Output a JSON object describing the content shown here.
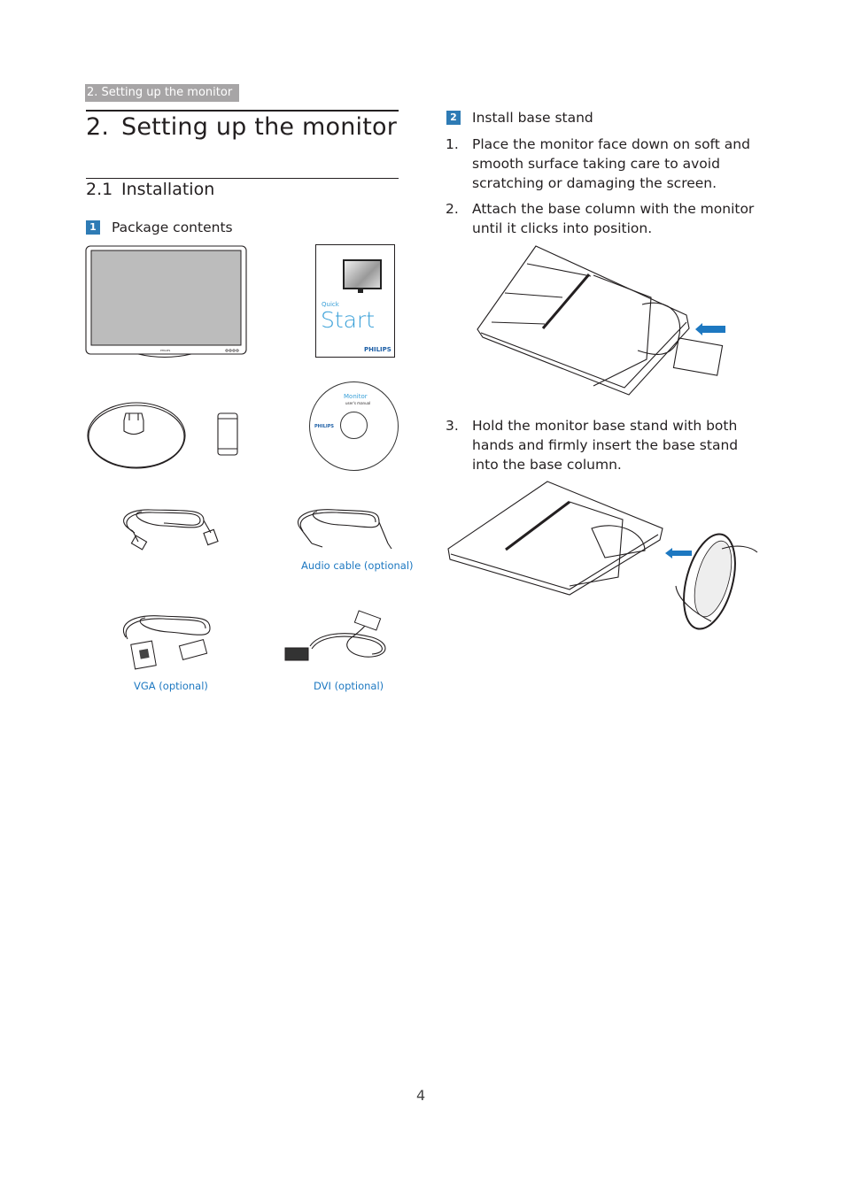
{
  "running_head": "2. Setting up the monitor",
  "heading1": {
    "number": "2.",
    "title": "Setting up the monitor"
  },
  "heading2": {
    "number": "2.1",
    "title": "Installation"
  },
  "section1": {
    "badge": "1",
    "title": "Package contents"
  },
  "package_items": {
    "quick_start": {
      "line1": "Quick",
      "line2": "Start",
      "brand": "PHILIPS"
    },
    "cd": {
      "title": "Monitor",
      "subtitle": "user's manual",
      "brand": "PHILIPS"
    },
    "audio_caption": "Audio cable (optional)",
    "vga_caption": "VGA (optional)",
    "dvi_caption": "DVI (optional)"
  },
  "section2": {
    "badge": "2",
    "title": "Install base stand",
    "steps": [
      {
        "n": "1.",
        "text": "Place the monitor face down on soft and smooth surface taking care to avoid scratching or damaging the screen."
      },
      {
        "n": "2.",
        "text": "Attach the base column with the monitor until it clicks into position."
      },
      {
        "n": "3.",
        "text": "Hold the monitor base stand with both hands and firmly insert the base stand into the base column."
      }
    ],
    "arrow_color": "#1d78c1"
  },
  "colors": {
    "accent": "#2e7bb5",
    "caption": "#1d78c1",
    "running_head_bg": "#a7a5a6"
  },
  "page_number": "4"
}
